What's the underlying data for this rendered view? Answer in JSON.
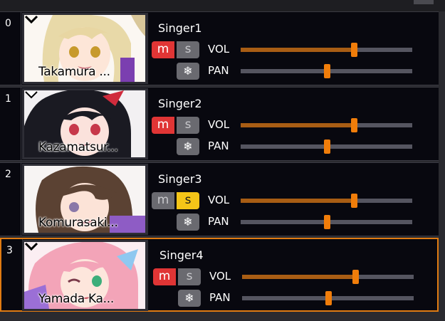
{
  "colors": {
    "accent": "#f07d0a",
    "mute_on": "#e03535",
    "solo_on": "#f5c518",
    "bg": "#08080f"
  },
  "tracks": [
    {
      "index": "0",
      "singer": "Takamura ...",
      "name": "Singer1",
      "mute_label": "m",
      "solo_label": "s",
      "freeze_icon": "snowflake-icon",
      "freeze_glyph": "❄",
      "vol_label": "VOL",
      "pan_label": "PAN",
      "vol": 0.66,
      "pan": 0.5,
      "muted": true,
      "solo": false,
      "selected": false,
      "chevron": "chevron-down-icon"
    },
    {
      "index": "1",
      "singer": "Kazamatsur...",
      "name": "Singer2",
      "mute_label": "m",
      "solo_label": "s",
      "freeze_icon": "snowflake-icon",
      "freeze_glyph": "❄",
      "vol_label": "VOL",
      "pan_label": "PAN",
      "vol": 0.66,
      "pan": 0.5,
      "muted": true,
      "solo": false,
      "selected": false,
      "chevron": "chevron-down-icon"
    },
    {
      "index": "2",
      "singer": "Komurasaki...",
      "name": "Singer3",
      "mute_label": "m",
      "solo_label": "s",
      "freeze_icon": "snowflake-icon",
      "freeze_glyph": "❄",
      "vol_label": "VOL",
      "pan_label": "PAN",
      "vol": 0.66,
      "pan": 0.5,
      "muted": false,
      "solo": true,
      "selected": false,
      "chevron": "chevron-down-icon"
    },
    {
      "index": "3",
      "singer": "Yamada Ka...",
      "name": "Singer4",
      "mute_label": "m",
      "solo_label": "s",
      "freeze_icon": "snowflake-icon",
      "freeze_glyph": "❄",
      "vol_label": "VOL",
      "pan_label": "PAN",
      "vol": 0.66,
      "pan": 0.5,
      "muted": true,
      "solo": false,
      "selected": true,
      "chevron": "chevron-down-icon"
    }
  ]
}
